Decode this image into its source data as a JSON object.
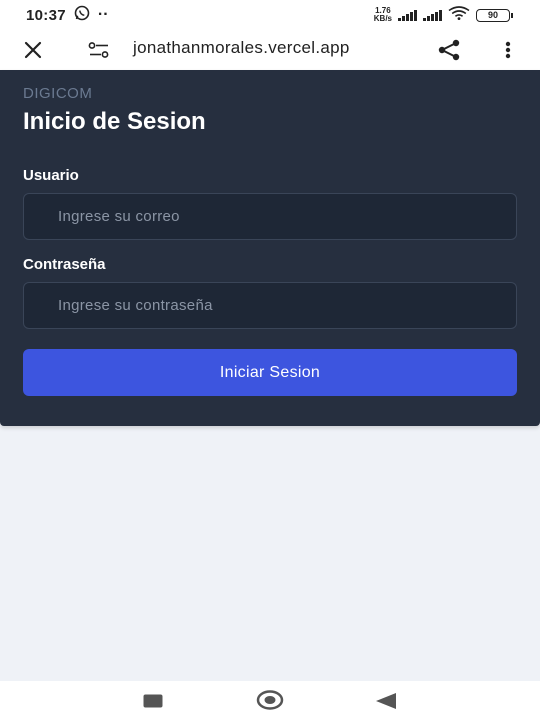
{
  "status_bar": {
    "time": "10:37",
    "notification_dots": "··",
    "net_speed_value": "1.76",
    "net_speed_unit": "KB/s",
    "battery": "90"
  },
  "browser": {
    "url": "jonathanmorales.vercel.app"
  },
  "login": {
    "brand": "DIGICOM",
    "title": "Inicio de Sesion",
    "username_label": "Usuario",
    "username_placeholder": "Ingrese su correo",
    "password_label": "Contraseña",
    "password_placeholder": "Ingrese su contraseña",
    "submit_label": "Iniciar Sesion"
  },
  "colors": {
    "card_background": "#262f3f",
    "input_background": "#1e2736",
    "primary_button": "#3d55df",
    "page_background": "#eff2f7"
  },
  "icons": {
    "close": "close-icon",
    "site_settings": "tune-icon",
    "share": "share-icon",
    "menu": "more-vert-icon",
    "whatsapp": "whatsapp-icon",
    "wifi": "wifi-icon",
    "nav_recents": "square-icon",
    "nav_home": "circle-icon",
    "nav_back": "triangle-back-icon"
  }
}
